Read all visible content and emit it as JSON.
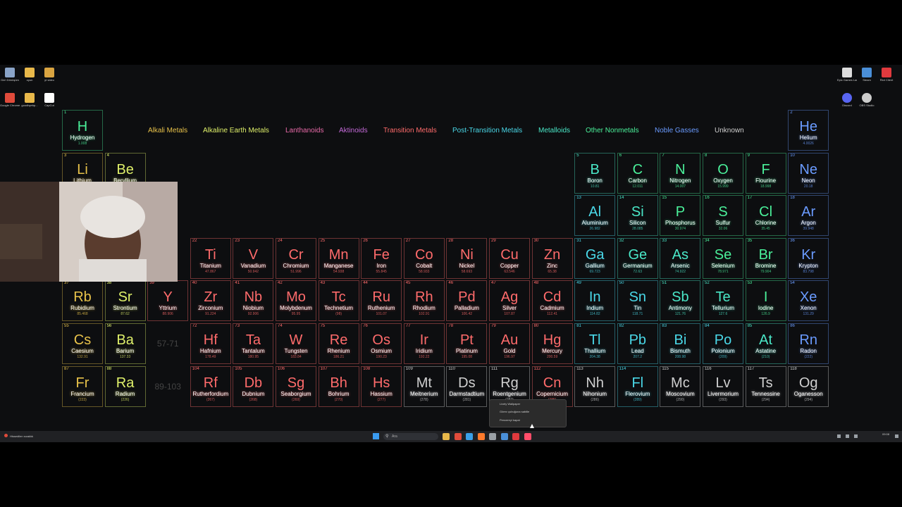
{
  "desktop": {
    "left_icons": [
      {
        "icon": "recycle-bin-icon",
        "label": "Geri Dönüşüm",
        "color": "#8aa4c8"
      },
      {
        "icon": "folder-icon",
        "label": "oyun",
        "color": "#e8b84a"
      },
      {
        "icon": "video-folder-icon",
        "label": "yt video",
        "color": "#d9a441"
      },
      {
        "icon": "chrome-icon",
        "label": "Google Chrome",
        "color": "#e04b3b"
      },
      {
        "icon": "folder-icon",
        "label": "goodbyebp...",
        "color": "#e8b84a"
      },
      {
        "icon": "capcut-icon",
        "label": "CapCut",
        "color": "#ffffff"
      }
    ],
    "right_icons": [
      {
        "icon": "epic-games-icon",
        "label": "Epic Games Launcher",
        "color": "#dddddd"
      },
      {
        "icon": "steam-icon",
        "label": "Steam",
        "color": "#4a8fd8"
      },
      {
        "icon": "riot-client-icon",
        "label": "Riot Client",
        "color": "#e03a3e"
      },
      {
        "icon": "discord-icon",
        "label": "Discord",
        "color": "#5865f2"
      },
      {
        "icon": "obs-icon",
        "label": "OBS Studio",
        "color": "#cccccc"
      }
    ]
  },
  "colors": {
    "alkali": "#e8c24a",
    "alkaline": "#dff06a",
    "lanthanide": "#e86aa8",
    "actinide": "#c46ad8",
    "transition": "#ff6b6b",
    "post_transition": "#4ad8e8",
    "metalloid": "#4ae8c8",
    "nonmetal": "#4af09a",
    "noble": "#6a9bff",
    "unknown": "#cfcfcf"
  },
  "legend": [
    {
      "label": "Alkali Metals",
      "cat": "alkali"
    },
    {
      "label": "Alkaline Earth Metals",
      "cat": "alkaline"
    },
    {
      "label": "Lanthanoids",
      "cat": "lanthanide"
    },
    {
      "label": "Aktinoids",
      "cat": "actinide"
    },
    {
      "label": "Transition Metals",
      "cat": "transition"
    },
    {
      "label": "Post-Transition Metals",
      "cat": "post_transition"
    },
    {
      "label": "Metalloids",
      "cat": "metalloid"
    },
    {
      "label": "Other Nonmetals",
      "cat": "nonmetal"
    },
    {
      "label": "Noble Gasses",
      "cat": "noble"
    },
    {
      "label": "Unknown",
      "cat": "unknown"
    }
  ],
  "elements": [
    {
      "n": "1",
      "s": "H",
      "name": "Hydrogen",
      "m": "1.008",
      "p": 1,
      "g": 1,
      "c": "nonmetal"
    },
    {
      "n": "2",
      "s": "He",
      "name": "Helium",
      "m": "4.0026",
      "p": 1,
      "g": 18,
      "c": "noble"
    },
    {
      "n": "3",
      "s": "Li",
      "name": "Lithium",
      "m": "6.94",
      "p": 2,
      "g": 1,
      "c": "alkali"
    },
    {
      "n": "4",
      "s": "Be",
      "name": "Beryllium",
      "m": "9.0122",
      "p": 2,
      "g": 2,
      "c": "alkaline"
    },
    {
      "n": "5",
      "s": "B",
      "name": "Boron",
      "m": "10.81",
      "p": 2,
      "g": 13,
      "c": "metalloid"
    },
    {
      "n": "6",
      "s": "C",
      "name": "Carbon",
      "m": "12.011",
      "p": 2,
      "g": 14,
      "c": "nonmetal"
    },
    {
      "n": "7",
      "s": "N",
      "name": "Nitrogen",
      "m": "14.007",
      "p": 2,
      "g": 15,
      "c": "nonmetal"
    },
    {
      "n": "8",
      "s": "O",
      "name": "Oxygen",
      "m": "15.999",
      "p": 2,
      "g": 16,
      "c": "nonmetal"
    },
    {
      "n": "9",
      "s": "F",
      "name": "Flourine",
      "m": "18.998",
      "p": 2,
      "g": 17,
      "c": "nonmetal"
    },
    {
      "n": "10",
      "s": "Ne",
      "name": "Neon",
      "m": "20.18",
      "p": 2,
      "g": 18,
      "c": "noble"
    },
    {
      "n": "13",
      "s": "Al",
      "name": "Aluminium",
      "m": "26.982",
      "p": 3,
      "g": 13,
      "c": "post_transition"
    },
    {
      "n": "14",
      "s": "Si",
      "name": "Silicon",
      "m": "28.085",
      "p": 3,
      "g": 14,
      "c": "metalloid"
    },
    {
      "n": "15",
      "s": "P",
      "name": "Phosphorus",
      "m": "30.974",
      "p": 3,
      "g": 15,
      "c": "nonmetal"
    },
    {
      "n": "16",
      "s": "S",
      "name": "Sulfur",
      "m": "32.06",
      "p": 3,
      "g": 16,
      "c": "nonmetal"
    },
    {
      "n": "17",
      "s": "Cl",
      "name": "Chlorine",
      "m": "35.45",
      "p": 3,
      "g": 17,
      "c": "nonmetal"
    },
    {
      "n": "18",
      "s": "Ar",
      "name": "Argon",
      "m": "39.948",
      "p": 3,
      "g": 18,
      "c": "noble"
    },
    {
      "n": "22",
      "s": "Ti",
      "name": "Titanium",
      "m": "47.867",
      "p": 4,
      "g": 4,
      "c": "transition"
    },
    {
      "n": "23",
      "s": "V",
      "name": "Vanadium",
      "m": "50.942",
      "p": 4,
      "g": 5,
      "c": "transition"
    },
    {
      "n": "24",
      "s": "Cr",
      "name": "Chromium",
      "m": "51.996",
      "p": 4,
      "g": 6,
      "c": "transition"
    },
    {
      "n": "25",
      "s": "Mn",
      "name": "Manganese",
      "m": "54.938",
      "p": 4,
      "g": 7,
      "c": "transition"
    },
    {
      "n": "26",
      "s": "Fe",
      "name": "Iron",
      "m": "55.845",
      "p": 4,
      "g": 8,
      "c": "transition"
    },
    {
      "n": "27",
      "s": "Co",
      "name": "Cobalt",
      "m": "58.933",
      "p": 4,
      "g": 9,
      "c": "transition"
    },
    {
      "n": "28",
      "s": "Ni",
      "name": "Nickel",
      "m": "58.693",
      "p": 4,
      "g": 10,
      "c": "transition"
    },
    {
      "n": "29",
      "s": "Cu",
      "name": "Copper",
      "m": "63.546",
      "p": 4,
      "g": 11,
      "c": "transition"
    },
    {
      "n": "30",
      "s": "Zn",
      "name": "Zinc",
      "m": "65.38",
      "p": 4,
      "g": 12,
      "c": "transition"
    },
    {
      "n": "31",
      "s": "Ga",
      "name": "Gallium",
      "m": "69.723",
      "p": 4,
      "g": 13,
      "c": "post_transition"
    },
    {
      "n": "32",
      "s": "Ge",
      "name": "Germanium",
      "m": "72.63",
      "p": 4,
      "g": 14,
      "c": "metalloid"
    },
    {
      "n": "33",
      "s": "As",
      "name": "Arsenic",
      "m": "74.922",
      "p": 4,
      "g": 15,
      "c": "metalloid"
    },
    {
      "n": "34",
      "s": "Se",
      "name": "Selenium",
      "m": "78.971",
      "p": 4,
      "g": 16,
      "c": "nonmetal"
    },
    {
      "n": "35",
      "s": "Br",
      "name": "Bromine",
      "m": "79.904",
      "p": 4,
      "g": 17,
      "c": "nonmetal"
    },
    {
      "n": "36",
      "s": "Kr",
      "name": "Krypton",
      "m": "83.798",
      "p": 4,
      "g": 18,
      "c": "noble"
    },
    {
      "n": "37",
      "s": "Rb",
      "name": "Rubidium",
      "m": "85.468",
      "p": 5,
      "g": 1,
      "c": "alkali"
    },
    {
      "n": "38",
      "s": "Sr",
      "name": "Strontium",
      "m": "87.62",
      "p": 5,
      "g": 2,
      "c": "alkaline"
    },
    {
      "n": "39",
      "s": "Y",
      "name": "Yttrium",
      "m": "88.906",
      "p": 5,
      "g": 3,
      "c": "transition"
    },
    {
      "n": "40",
      "s": "Zr",
      "name": "Zirconium",
      "m": "91.224",
      "p": 5,
      "g": 4,
      "c": "transition"
    },
    {
      "n": "41",
      "s": "Nb",
      "name": "Niobium",
      "m": "92.906",
      "p": 5,
      "g": 5,
      "c": "transition"
    },
    {
      "n": "42",
      "s": "Mo",
      "name": "Molybdenum",
      "m": "95.95",
      "p": 5,
      "g": 6,
      "c": "transition"
    },
    {
      "n": "43",
      "s": "Tc",
      "name": "Technetium",
      "m": "(98)",
      "p": 5,
      "g": 7,
      "c": "transition"
    },
    {
      "n": "44",
      "s": "Ru",
      "name": "Ruthenium",
      "m": "101.07",
      "p": 5,
      "g": 8,
      "c": "transition"
    },
    {
      "n": "45",
      "s": "Rh",
      "name": "Rhodium",
      "m": "102.91",
      "p": 5,
      "g": 9,
      "c": "transition"
    },
    {
      "n": "46",
      "s": "Pd",
      "name": "Palladium",
      "m": "106.42",
      "p": 5,
      "g": 10,
      "c": "transition"
    },
    {
      "n": "47",
      "s": "Ag",
      "name": "Silver",
      "m": "107.87",
      "p": 5,
      "g": 11,
      "c": "transition"
    },
    {
      "n": "48",
      "s": "Cd",
      "name": "Cadmium",
      "m": "112.41",
      "p": 5,
      "g": 12,
      "c": "transition"
    },
    {
      "n": "49",
      "s": "In",
      "name": "Indium",
      "m": "114.82",
      "p": 5,
      "g": 13,
      "c": "post_transition"
    },
    {
      "n": "50",
      "s": "Sn",
      "name": "Tin",
      "m": "118.71",
      "p": 5,
      "g": 14,
      "c": "post_transition"
    },
    {
      "n": "51",
      "s": "Sb",
      "name": "Antimony",
      "m": "121.76",
      "p": 5,
      "g": 15,
      "c": "metalloid"
    },
    {
      "n": "52",
      "s": "Te",
      "name": "Tellurium",
      "m": "127.6",
      "p": 5,
      "g": 16,
      "c": "metalloid"
    },
    {
      "n": "53",
      "s": "I",
      "name": "Iodine",
      "m": "126.9",
      "p": 5,
      "g": 17,
      "c": "nonmetal"
    },
    {
      "n": "54",
      "s": "Xe",
      "name": "Xenon",
      "m": "131.29",
      "p": 5,
      "g": 18,
      "c": "noble"
    },
    {
      "n": "55",
      "s": "Cs",
      "name": "Caesium",
      "m": "132.91",
      "p": 6,
      "g": 1,
      "c": "alkali"
    },
    {
      "n": "56",
      "s": "Ba",
      "name": "Barium",
      "m": "137.33",
      "p": 6,
      "g": 2,
      "c": "alkaline"
    },
    {
      "n": "72",
      "s": "Hf",
      "name": "Hafnium",
      "m": "178.49",
      "p": 6,
      "g": 4,
      "c": "transition"
    },
    {
      "n": "73",
      "s": "Ta",
      "name": "Tantalum",
      "m": "180.95",
      "p": 6,
      "g": 5,
      "c": "transition"
    },
    {
      "n": "74",
      "s": "W",
      "name": "Tungsten",
      "m": "183.84",
      "p": 6,
      "g": 6,
      "c": "transition"
    },
    {
      "n": "75",
      "s": "Re",
      "name": "Rhenium",
      "m": "186.21",
      "p": 6,
      "g": 7,
      "c": "transition"
    },
    {
      "n": "76",
      "s": "Os",
      "name": "Osmium",
      "m": "190.23",
      "p": 6,
      "g": 8,
      "c": "transition"
    },
    {
      "n": "77",
      "s": "Ir",
      "name": "Iridium",
      "m": "192.22",
      "p": 6,
      "g": 9,
      "c": "transition"
    },
    {
      "n": "78",
      "s": "Pt",
      "name": "Platinum",
      "m": "195.08",
      "p": 6,
      "g": 10,
      "c": "transition"
    },
    {
      "n": "79",
      "s": "Au",
      "name": "Gold",
      "m": "196.97",
      "p": 6,
      "g": 11,
      "c": "transition"
    },
    {
      "n": "80",
      "s": "Hg",
      "name": "Mercury",
      "m": "200.59",
      "p": 6,
      "g": 12,
      "c": "transition"
    },
    {
      "n": "81",
      "s": "Tl",
      "name": "Thallium",
      "m": "204.38",
      "p": 6,
      "g": 13,
      "c": "post_transition"
    },
    {
      "n": "82",
      "s": "Pb",
      "name": "Lead",
      "m": "207.2",
      "p": 6,
      "g": 14,
      "c": "post_transition"
    },
    {
      "n": "83",
      "s": "Bi",
      "name": "Bismuth",
      "m": "208.98",
      "p": 6,
      "g": 15,
      "c": "post_transition"
    },
    {
      "n": "84",
      "s": "Po",
      "name": "Polonium",
      "m": "(209)",
      "p": 6,
      "g": 16,
      "c": "post_transition"
    },
    {
      "n": "85",
      "s": "At",
      "name": "Astatine",
      "m": "(210)",
      "p": 6,
      "g": 17,
      "c": "metalloid"
    },
    {
      "n": "86",
      "s": "Rn",
      "name": "Radon",
      "m": "(222)",
      "p": 6,
      "g": 18,
      "c": "noble"
    },
    {
      "n": "87",
      "s": "Fr",
      "name": "Francium",
      "m": "(223)",
      "p": 7,
      "g": 1,
      "c": "alkali"
    },
    {
      "n": "88",
      "s": "Ra",
      "name": "Radium",
      "m": "(226)",
      "p": 7,
      "g": 2,
      "c": "alkaline"
    },
    {
      "n": "104",
      "s": "Rf",
      "name": "Rutherfordium",
      "m": "(267)",
      "p": 7,
      "g": 4,
      "c": "transition"
    },
    {
      "n": "105",
      "s": "Db",
      "name": "Dubnium",
      "m": "(268)",
      "p": 7,
      "g": 5,
      "c": "transition"
    },
    {
      "n": "106",
      "s": "Sg",
      "name": "Seaborgium",
      "m": "(269)",
      "p": 7,
      "g": 6,
      "c": "transition"
    },
    {
      "n": "107",
      "s": "Bh",
      "name": "Bohrium",
      "m": "(270)",
      "p": 7,
      "g": 7,
      "c": "transition"
    },
    {
      "n": "108",
      "s": "Hs",
      "name": "Hassium",
      "m": "(277)",
      "p": 7,
      "g": 8,
      "c": "transition"
    },
    {
      "n": "109",
      "s": "Mt",
      "name": "Meitnerium",
      "m": "(278)",
      "p": 7,
      "g": 9,
      "c": "unknown"
    },
    {
      "n": "110",
      "s": "Ds",
      "name": "Darmstadtium",
      "m": "(281)",
      "p": 7,
      "g": 10,
      "c": "unknown"
    },
    {
      "n": "111",
      "s": "Rg",
      "name": "Roentgenium",
      "m": "(282)",
      "p": 7,
      "g": 11,
      "c": "unknown"
    },
    {
      "n": "112",
      "s": "Cn",
      "name": "Copernicium",
      "m": "(285)",
      "p": 7,
      "g": 12,
      "c": "transition"
    },
    {
      "n": "113",
      "s": "Nh",
      "name": "Nihonium",
      "m": "(286)",
      "p": 7,
      "g": 13,
      "c": "unknown"
    },
    {
      "n": "114",
      "s": "Fl",
      "name": "Flerovium",
      "m": "(289)",
      "p": 7,
      "g": 14,
      "c": "post_transition"
    },
    {
      "n": "115",
      "s": "Mc",
      "name": "Moscovium",
      "m": "(290)",
      "p": 7,
      "g": 15,
      "c": "unknown"
    },
    {
      "n": "116",
      "s": "Lv",
      "name": "Livermorium",
      "m": "(293)",
      "p": 7,
      "g": 16,
      "c": "unknown"
    },
    {
      "n": "117",
      "s": "Ts",
      "name": "Tennessine",
      "m": "(294)",
      "p": 7,
      "g": 17,
      "c": "unknown"
    },
    {
      "n": "118",
      "s": "Og",
      "name": "Oganesson",
      "m": "(294)",
      "p": 7,
      "g": 18,
      "c": "unknown"
    }
  ],
  "placeholders": [
    {
      "label": "57-71",
      "p": 6,
      "g": 3
    },
    {
      "label": "89-103",
      "p": 7,
      "g": 3
    }
  ],
  "context_menu": {
    "items": [
      "Lively Wallpaper",
      "Görev çubuğuna sabitle",
      "Pencereyi kapat"
    ]
  },
  "taskbar": {
    "left_label": "Hissedilen sıcaklık",
    "search_placeholder": "Ara",
    "apps": [
      {
        "icon": "file-explorer-icon",
        "color": "#e8b84a"
      },
      {
        "icon": "chrome-taskbar-icon",
        "color": "#e04b3b"
      },
      {
        "icon": "edge-icon",
        "color": "#3aa0e8"
      },
      {
        "icon": "firefox-icon",
        "color": "#ff7a2b"
      },
      {
        "icon": "settings-taskbar-icon",
        "color": "#9aa0a6"
      },
      {
        "icon": "steam-taskbar-icon",
        "color": "#4a8fd8"
      },
      {
        "icon": "riot-taskbar-icon",
        "color": "#e03a3e"
      },
      {
        "icon": "lively-taskbar-icon",
        "color": "#ff4d6a"
      }
    ],
    "time": "09:08"
  }
}
